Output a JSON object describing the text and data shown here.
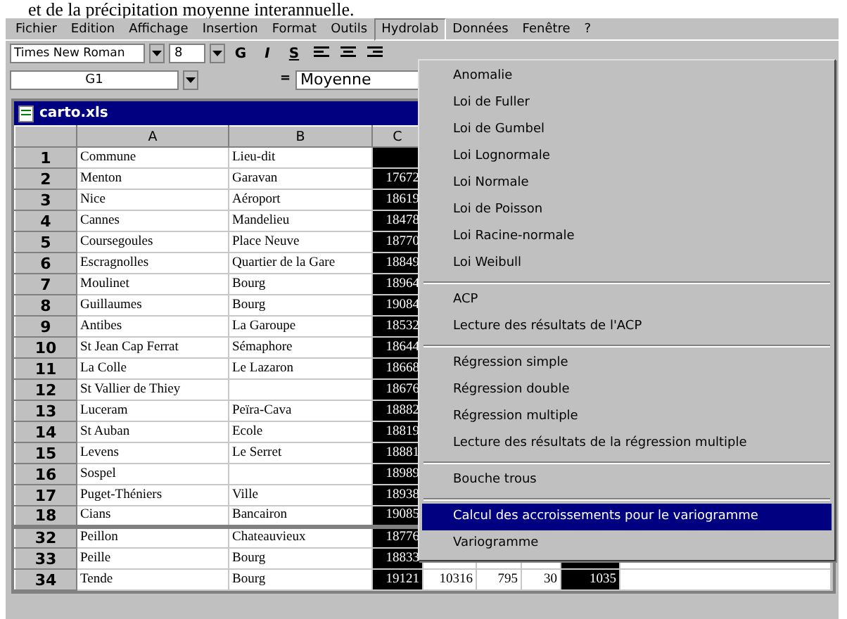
{
  "caption": "et de la précipitation moyenne interannuelle.",
  "menubar": [
    {
      "label": "Fichier",
      "selected": false
    },
    {
      "label": "Edition",
      "selected": false
    },
    {
      "label": "Affichage",
      "selected": false
    },
    {
      "label": "Insertion",
      "selected": false
    },
    {
      "label": "Format",
      "selected": false
    },
    {
      "label": "Outils",
      "selected": false
    },
    {
      "label": "Hydrolab",
      "selected": true
    },
    {
      "label": "Données",
      "selected": false
    },
    {
      "label": "Fenêtre",
      "selected": false
    },
    {
      "label": "?",
      "selected": false
    }
  ],
  "toolbar": {
    "font": "Times New Roman",
    "size": "8",
    "bold": "G",
    "italic": "I",
    "underline": "S"
  },
  "formula_bar": {
    "name_box": "G1",
    "equals": "=",
    "content": "Moyenne"
  },
  "workbook": {
    "title": "carto.xls",
    "columns": [
      {
        "label": "A",
        "selected": false
      },
      {
        "label": "B",
        "selected": false
      },
      {
        "label": "C",
        "selected": true
      },
      {
        "selected": false
      },
      {
        "selected": false
      },
      {
        "selected": false
      },
      {
        "selected": true
      }
    ],
    "rows": [
      {
        "header": "1",
        "cells": [
          "Commune",
          "Lieu-dit",
          null
        ]
      },
      {
        "header": "2",
        "cells": [
          "Menton",
          "Garavan",
          "17672"
        ]
      },
      {
        "header": "3",
        "cells": [
          "Nice",
          "Aéroport",
          "18619"
        ]
      },
      {
        "header": "4",
        "cells": [
          "Cannes",
          "Mandelieu",
          "18478"
        ]
      },
      {
        "header": "5",
        "cells": [
          "Coursegoules",
          "Place Neuve",
          "18770"
        ]
      },
      {
        "header": "6",
        "cells": [
          "Escragnolles",
          "Quartier de la Gare",
          "18849"
        ]
      },
      {
        "header": "7",
        "cells": [
          "Moulinet",
          "Bourg",
          "18964"
        ]
      },
      {
        "header": "8",
        "cells": [
          "Guillaumes",
          "Bourg",
          "19084"
        ]
      },
      {
        "header": "9",
        "cells": [
          "Antibes",
          "La Garoupe",
          "18532"
        ]
      },
      {
        "header": "10",
        "cells": [
          "St Jean Cap Ferrat",
          "Sémaphore",
          "18644"
        ]
      },
      {
        "header": "11",
        "cells": [
          "La Colle",
          "Le Lazaron",
          "18668"
        ]
      },
      {
        "header": "12",
        "cells": [
          "St Vallier de Thiey",
          null,
          "18676"
        ]
      },
      {
        "header": "13",
        "cells": [
          "Luceram",
          "Peïra-Cava",
          "18882"
        ]
      },
      {
        "header": "14",
        "cells": [
          "St Auban",
          "Ecole",
          "18819"
        ]
      },
      {
        "header": "15",
        "cells": [
          "Levens",
          "Le Serret",
          "18881"
        ]
      },
      {
        "header": "16",
        "cells": [
          "Sospel",
          null,
          "18989"
        ]
      },
      {
        "header": "17",
        "cells": [
          "Puget-Théniers",
          "Ville",
          "18938"
        ]
      },
      {
        "header": "18",
        "cells": [
          "Cians",
          "Bancairon",
          "19085"
        ]
      },
      {
        "header": "32",
        "cells": [
          "Peillon",
          "Chateauvieux",
          "18776"
        ]
      },
      {
        "header": "33",
        "cells": [
          "Peille",
          "Bourg",
          "18833"
        ]
      },
      {
        "header": "34",
        "cells": [
          "Tende",
          "Bourg",
          "19121",
          "10316",
          "795",
          "30",
          "1035"
        ]
      }
    ]
  },
  "menu": [
    {
      "kind": "item",
      "label": "Anomalie",
      "selected": false
    },
    {
      "kind": "item",
      "label": "Loi de Fuller",
      "selected": false
    },
    {
      "kind": "item",
      "label": "Loi de Gumbel",
      "selected": false
    },
    {
      "kind": "item",
      "label": "Loi Lognormale",
      "selected": false
    },
    {
      "kind": "item",
      "label": "Loi Normale",
      "selected": false
    },
    {
      "kind": "item",
      "label": "Loi de Poisson",
      "selected": false
    },
    {
      "kind": "item",
      "label": "Loi Racine-normale",
      "selected": false
    },
    {
      "kind": "item",
      "label": "Loi Weibull",
      "selected": false
    },
    {
      "kind": "separator"
    },
    {
      "kind": "item",
      "label": "ACP",
      "selected": false
    },
    {
      "kind": "item",
      "label": "Lecture des résultats de l'ACP",
      "selected": false
    },
    {
      "kind": "separator"
    },
    {
      "kind": "item",
      "label": "Régression simple",
      "selected": false
    },
    {
      "kind": "item",
      "label": "Régression double",
      "selected": false
    },
    {
      "kind": "item",
      "label": "Régression multiple",
      "selected": false
    },
    {
      "kind": "item",
      "label": "Lecture des résultats de la régression multiple",
      "selected": false
    },
    {
      "kind": "separator"
    },
    {
      "kind": "item",
      "label": "Bouche trous",
      "selected": false
    },
    {
      "kind": "separator"
    },
    {
      "kind": "item",
      "label": "Calcul des accroissements pour le variogramme",
      "selected": true
    },
    {
      "kind": "item",
      "label": "Variogramme",
      "selected": false
    }
  ]
}
